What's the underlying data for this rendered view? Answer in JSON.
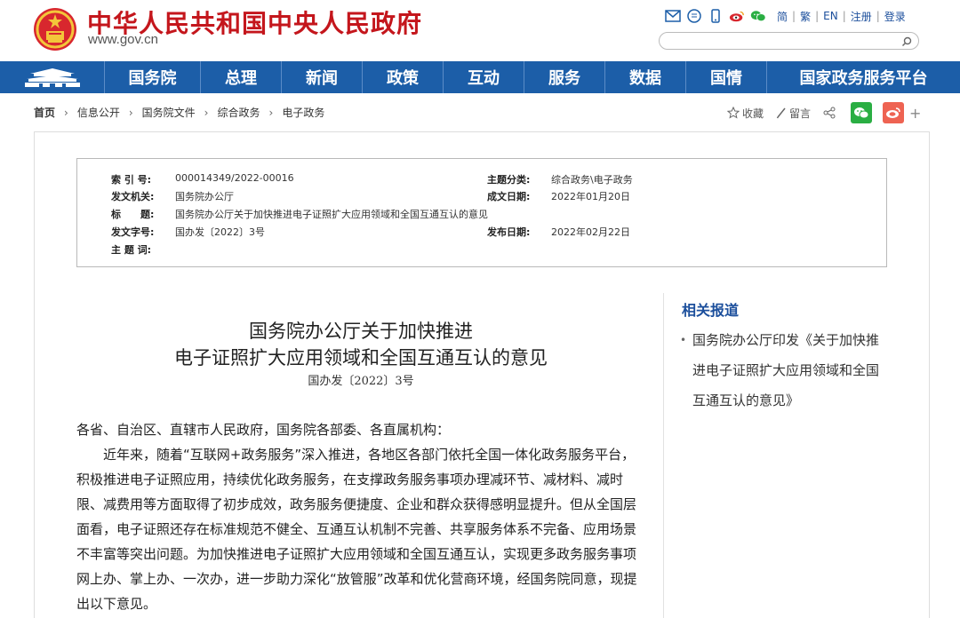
{
  "header": {
    "site_title": "中华人民共和国中央人民政府",
    "site_url": "www.gov.cn",
    "lang_links": [
      "简",
      "繁",
      "EN",
      "注册",
      "登录"
    ],
    "search_placeholder": ""
  },
  "nav": {
    "items": [
      "国务院",
      "总理",
      "新闻",
      "政策",
      "互动",
      "服务",
      "数据",
      "国情",
      "国家政务服务平台"
    ]
  },
  "breadcrumb": [
    "首页",
    "信息公开",
    "国务院文件",
    "综合政务",
    "电子政务"
  ],
  "share_bar": {
    "favorite": "收藏",
    "comment": "留言"
  },
  "meta": {
    "index_no_label": "索 引 号:",
    "index_no": "000014349/2022-00016",
    "topic_label": "主题分类:",
    "topic": "综合政务\\电子政务",
    "issuer_label": "发文机关:",
    "issuer": "国务院办公厅",
    "created_label": "成文日期:",
    "created": "2022年01月20日",
    "title_label": "标　　题:",
    "title": "国务院办公厅关于加快推进电子证照扩大应用领域和全国互通互认的意见",
    "docno_label": "发文字号:",
    "docno": "国办发〔2022〕3号",
    "published_label": "发布日期:",
    "published": "2022年02月22日",
    "keywords_label": "主 题 词:"
  },
  "article": {
    "title_line1": "国务院办公厅关于加快推进",
    "title_line2": "电子证照扩大应用领域和全国互通互认的意见",
    "doc_no": "国办发〔2022〕3号",
    "salutation": "各省、自治区、直辖市人民政府，国务院各部委、各直属机构：",
    "para1": "近年来，随着“互联网+政务服务”深入推进，各地区各部门依托全国一体化政务服务平台，积极推进电子证照应用，持续优化政务服务，在支撑政务服务事项办理减环节、减材料、减时限、减费用等方面取得了初步成效，政务服务便捷度、企业和群众获得感明显提升。但从全国层面看，电子证照还存在标准规范不健全、互通互认机制不完善、共享服务体系不完备、应用场景不丰富等突出问题。为加快推进电子证照扩大应用领域和全国互通互认，实现更多政务服务事项网上办、掌上办、一次办，进一步助力深化“放管服”改革和优化营商环境，经国务院同意，现提出以下意见。"
  },
  "sidebar": {
    "title": "相关报道",
    "items": [
      "国务院办公厅印发《关于加快推进电子证照扩大应用领域和全国互通互认的意见》"
    ]
  },
  "colors": {
    "brand_red": "#c4161c",
    "nav_blue": "#1c5ea8",
    "link_blue": "#1c4f9c"
  }
}
